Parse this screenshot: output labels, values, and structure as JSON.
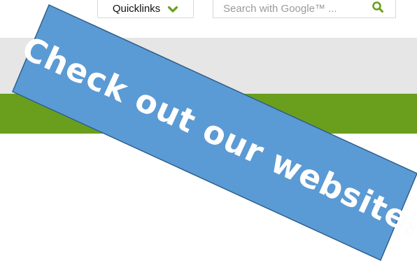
{
  "header": {
    "quicklinks_label": "Quicklinks",
    "quicklinks_icon": "chevron-down-icon",
    "search_placeholder": "Search with Google™ ...",
    "search_icon": "search-icon"
  },
  "banner": {
    "text": "Check out our website!"
  },
  "colors": {
    "accent_green": "#6a9f1e",
    "gray_band": "#e6e6e6",
    "sticker_fill": "#5b9bd5",
    "sticker_stroke": "#2f5f8a"
  }
}
